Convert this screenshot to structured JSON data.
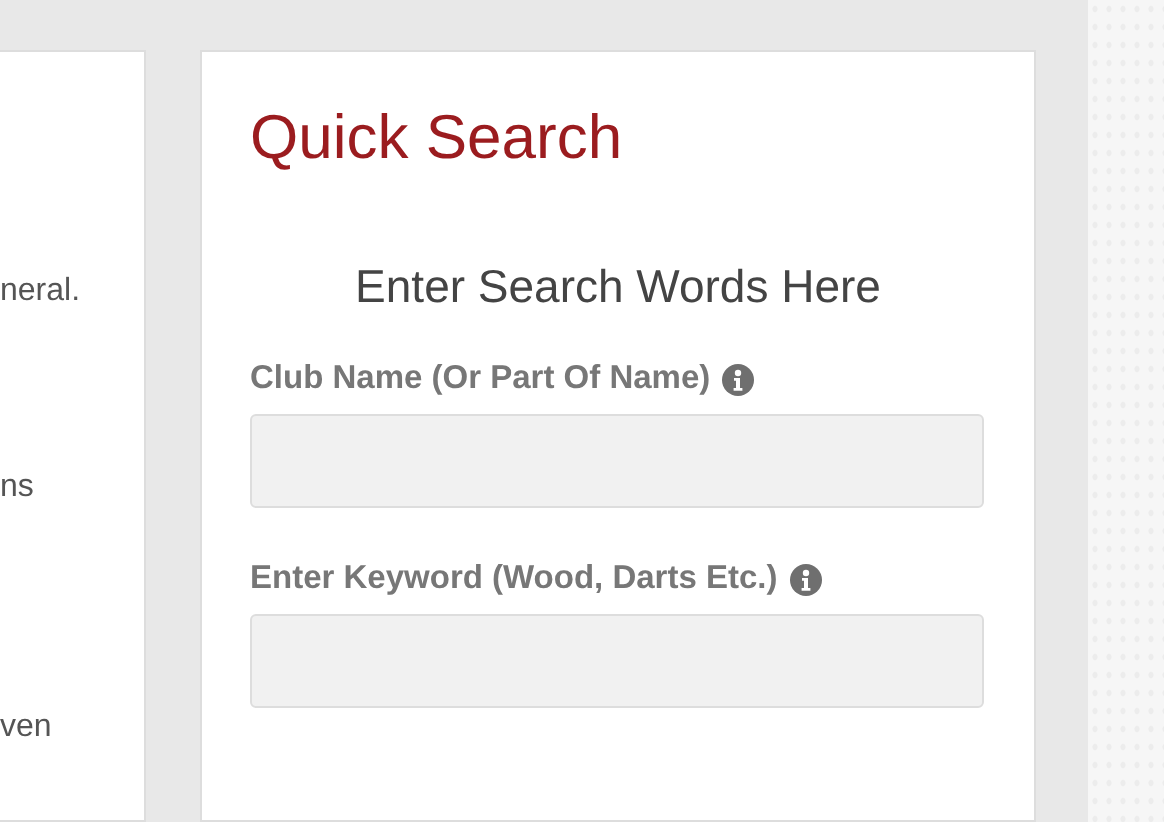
{
  "side_panel": {
    "text_fragments": [
      "neral.",
      "ns",
      "ven"
    ]
  },
  "quick_search": {
    "title": "Quick Search",
    "subtitle": "Enter Search Words Here",
    "fields": [
      {
        "label": "Club Name (Or Part Of Name)",
        "info": true
      },
      {
        "label": "Enter Keyword (Wood, Darts Etc.)",
        "info": true
      }
    ]
  }
}
